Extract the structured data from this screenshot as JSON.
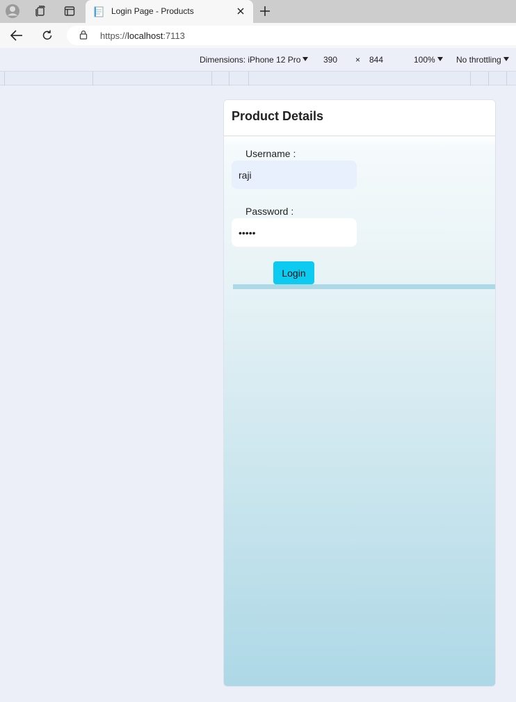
{
  "browser": {
    "tab": {
      "title": "Login Page - Products"
    },
    "url": {
      "scheme": "https://",
      "host": "localhost",
      "port": ":7113"
    }
  },
  "device_toolbar": {
    "dimensions_label": "Dimensions: iPhone 12 Pro",
    "width": "390",
    "times": "×",
    "height": "844",
    "zoom": "100%",
    "throttling": "No throttling"
  },
  "page": {
    "header": "Product Details",
    "username_label": "Username :",
    "username_value": "raji",
    "password_label": "Password :",
    "password_value": "12345",
    "login_button": "Login"
  },
  "colors": {
    "accent": "#0dcaf0",
    "gradient_end": "#add8e6",
    "autofill_bg": "#e8f0fe"
  }
}
